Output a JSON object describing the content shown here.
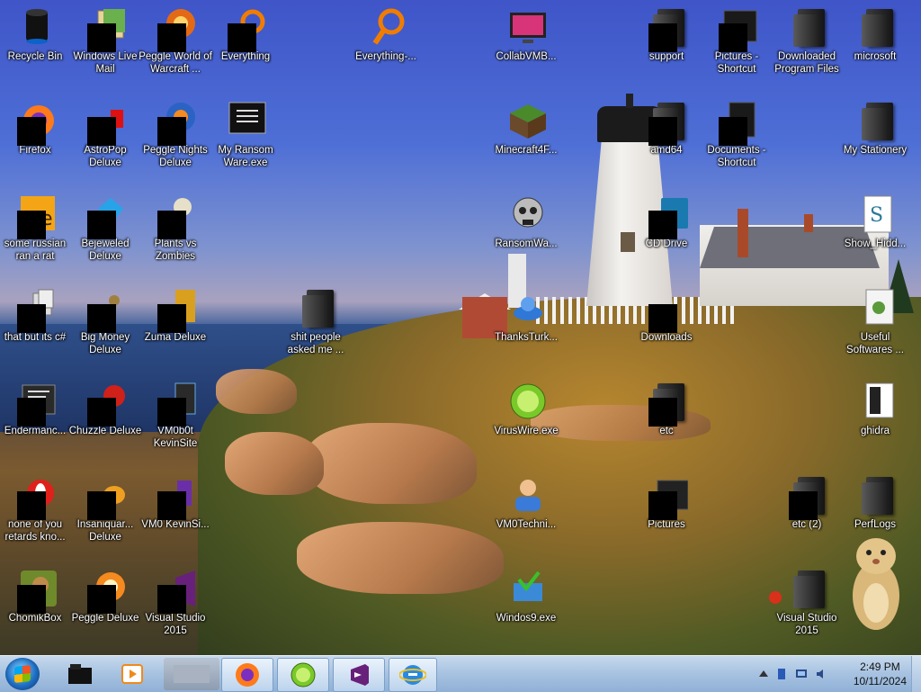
{
  "desktop": {
    "icons": [
      {
        "id": "recycle-bin",
        "label": "Recycle Bin"
      },
      {
        "id": "windows-live-mail",
        "label": "Windows Live Mail"
      },
      {
        "id": "peggle-wow",
        "label": "Peggle World of Warcraft ..."
      },
      {
        "id": "everything",
        "label": "Everything"
      },
      {
        "id": "everything-2",
        "label": "Everything-..."
      },
      {
        "id": "collabvmb",
        "label": "CollabVMB..."
      },
      {
        "id": "support",
        "label": "support"
      },
      {
        "id": "pictures-shortcut",
        "label": "Pictures - Shortcut"
      },
      {
        "id": "downloaded-program-files",
        "label": "Downloaded Program Files"
      },
      {
        "id": "microsoft",
        "label": "microsoft"
      },
      {
        "id": "firefox",
        "label": "Firefox"
      },
      {
        "id": "astropop",
        "label": "AstroPop Deluxe"
      },
      {
        "id": "peggle-nights",
        "label": "Peggle Nights Deluxe"
      },
      {
        "id": "my-ransom-ware",
        "label": "My Ransom Ware.exe"
      },
      {
        "id": "minecraft",
        "label": "Minecraft4F..."
      },
      {
        "id": "amd64",
        "label": "amd64"
      },
      {
        "id": "documents-shortcut",
        "label": "Documents - Shortcut"
      },
      {
        "id": "my-stationery",
        "label": "My Stationery"
      },
      {
        "id": "some-russian",
        "label": "some russian ran a rat"
      },
      {
        "id": "bejeweled",
        "label": "Bejeweled Deluxe"
      },
      {
        "id": "plants-vs-zombies",
        "label": "Plants vs Zombies"
      },
      {
        "id": "ransomwa",
        "label": "RansomWa..."
      },
      {
        "id": "cd-drive",
        "label": "CD Drive"
      },
      {
        "id": "show-hidd",
        "label": "Show_Hidd..."
      },
      {
        "id": "that-but-its-c",
        "label": "that but its c#"
      },
      {
        "id": "big-money",
        "label": "Big Money Deluxe"
      },
      {
        "id": "zuma-deluxe",
        "label": "Zuma Deluxe"
      },
      {
        "id": "shit-people",
        "label": "shit people asked me ..."
      },
      {
        "id": "thanksturk",
        "label": "ThanksTurk..."
      },
      {
        "id": "downloads",
        "label": "Downloads"
      },
      {
        "id": "useful-softwares",
        "label": "Useful Softwares ..."
      },
      {
        "id": "endermanc",
        "label": "Endermanc..."
      },
      {
        "id": "chuzzle",
        "label": "Chuzzle Deluxe"
      },
      {
        "id": "vm0b0t-kevinsite",
        "label": "VM0b0t KevinSite"
      },
      {
        "id": "viruswire",
        "label": "VirusWire.exe"
      },
      {
        "id": "etc",
        "label": "etc"
      },
      {
        "id": "ghidra",
        "label": "ghidra"
      },
      {
        "id": "none-of-you",
        "label": "none of you retards kno..."
      },
      {
        "id": "insaniquarium",
        "label": "Insaniquar... Deluxe"
      },
      {
        "id": "vm0-kevinsi",
        "label": "VM0 KevinSi..."
      },
      {
        "id": "vm0techni",
        "label": "VM0Techni..."
      },
      {
        "id": "pictures",
        "label": "Pictures"
      },
      {
        "id": "etc-2",
        "label": "etc (2)"
      },
      {
        "id": "perflogs",
        "label": "PerfLogs"
      },
      {
        "id": "chomikbox",
        "label": "ChomikBox"
      },
      {
        "id": "peggle-deluxe",
        "label": "Peggle Deluxe"
      },
      {
        "id": "visual-studio-2015",
        "label": "Visual Studio 2015"
      },
      {
        "id": "windos9",
        "label": "Windos9.exe"
      },
      {
        "id": "visual-studio-2015-b",
        "label": "Visual Studio 2015"
      }
    ]
  },
  "taskbar": {
    "items": [
      {
        "id": "tb-explorer",
        "icon": "folder-icon"
      },
      {
        "id": "tb-media",
        "icon": "media-player-icon"
      },
      {
        "id": "tb-blank",
        "icon": "blank-window-icon"
      },
      {
        "id": "tb-firefox",
        "icon": "firefox-icon"
      },
      {
        "id": "tb-lime",
        "icon": "lime-icon"
      },
      {
        "id": "tb-vs",
        "icon": "visual-studio-icon"
      },
      {
        "id": "tb-ie",
        "icon": "internet-explorer-icon"
      }
    ],
    "clock": {
      "time": "2:49 PM",
      "date": "10/11/2024"
    }
  },
  "colors": {
    "taskbar": "#a9c4e2",
    "accent": "#1f6fc4"
  }
}
